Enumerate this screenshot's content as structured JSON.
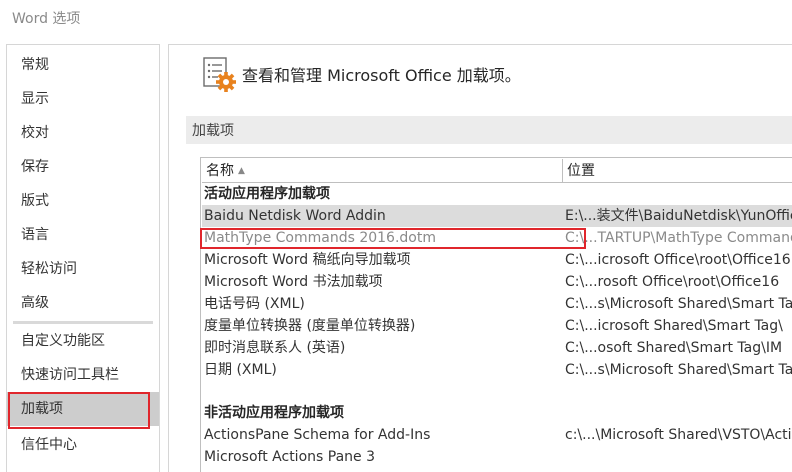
{
  "window": {
    "title": "Word 选项"
  },
  "sidebar": {
    "items": [
      {
        "label": "常规"
      },
      {
        "label": "显示"
      },
      {
        "label": "校对"
      },
      {
        "label": "保存"
      },
      {
        "label": "版式"
      },
      {
        "label": "语言"
      },
      {
        "label": "轻松访问"
      },
      {
        "label": "高级"
      },
      {
        "label": "自定义功能区"
      },
      {
        "label": "快速访问工具栏"
      },
      {
        "label": "加载项"
      },
      {
        "label": "信任中心"
      }
    ],
    "selected": "加载项"
  },
  "header": {
    "text": "查看和管理 Microsoft Office 加载项。",
    "icon": "addins-gear-icon"
  },
  "section": {
    "label": "加载项"
  },
  "table": {
    "columns": {
      "name": "名称",
      "location": "位置"
    },
    "groups": [
      {
        "label": "活动应用程序加载项",
        "rows": [
          {
            "name": "Baidu Netdisk Word Addin",
            "location": "E:\\...装文件\\BaiduNetdisk\\YunOffice"
          },
          {
            "name": "MathType Commands 2016.dotm",
            "location": "C:\\...TARTUP\\MathType Commands"
          },
          {
            "name": "Microsoft Word 稿纸向导加载项",
            "location": "C:\\...icrosoft Office\\root\\Office16"
          },
          {
            "name": "Microsoft Word 书法加载项",
            "location": "C:\\...rosoft Office\\root\\Office16"
          },
          {
            "name": "电话号码 (XML)",
            "location": "C:\\...s\\Microsoft Shared\\Smart Tag"
          },
          {
            "name": "度量单位转换器 (度量单位转换器)",
            "location": "C:\\...icrosoft Shared\\Smart Tag\\"
          },
          {
            "name": "即时消息联系人 (英语)",
            "location": "C:\\...osoft Shared\\Smart Tag\\IM"
          },
          {
            "name": "日期 (XML)",
            "location": "C:\\...s\\Microsoft Shared\\Smart Tag"
          }
        ]
      },
      {
        "label": "非活动应用程序加载项",
        "rows": [
          {
            "name": "ActionsPane Schema for Add-Ins",
            "location": "c:\\...\\Microsoft Shared\\VSTO\\Actio"
          },
          {
            "name": "Microsoft Actions Pane 3",
            "location": ""
          }
        ]
      }
    ]
  },
  "colors": {
    "selected_bg": "#cdcdcd",
    "highlight_box": "#e0262c",
    "row_highlight": "#dcdcdc",
    "gear": "#e8821e"
  }
}
